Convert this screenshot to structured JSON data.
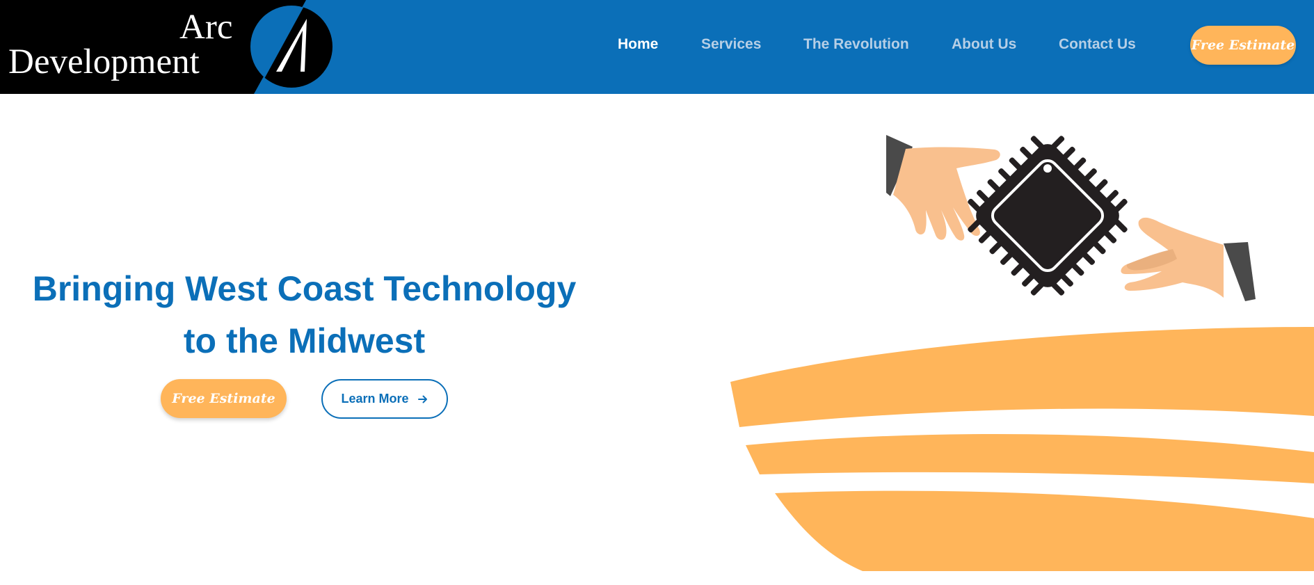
{
  "logo": {
    "line1": "Arc",
    "line2": "Development"
  },
  "nav": {
    "items": [
      {
        "label": "Home",
        "active": true
      },
      {
        "label": "Services",
        "active": false
      },
      {
        "label": "The Revolution",
        "active": false
      },
      {
        "label": "About Us",
        "active": false
      },
      {
        "label": "Contact Us",
        "active": false
      }
    ],
    "cta_label": "Free Estimate"
  },
  "hero": {
    "title_line1": "Bringing West Coast Technology",
    "title_line2": "to the Midwest",
    "estimate_label": "Free Estimate",
    "learn_more_label": "Learn More",
    "learn_more_icon": "arrow-right-icon",
    "illustration": "hands-exchanging-chip"
  },
  "colors": {
    "primary_blue": "#0b6fb8",
    "accent_orange": "#ffb55a",
    "nav_inactive": "#b6cfe6",
    "skin": "#f9c08e",
    "sleeve": "#4a4a4a",
    "chip": "#231f20"
  }
}
